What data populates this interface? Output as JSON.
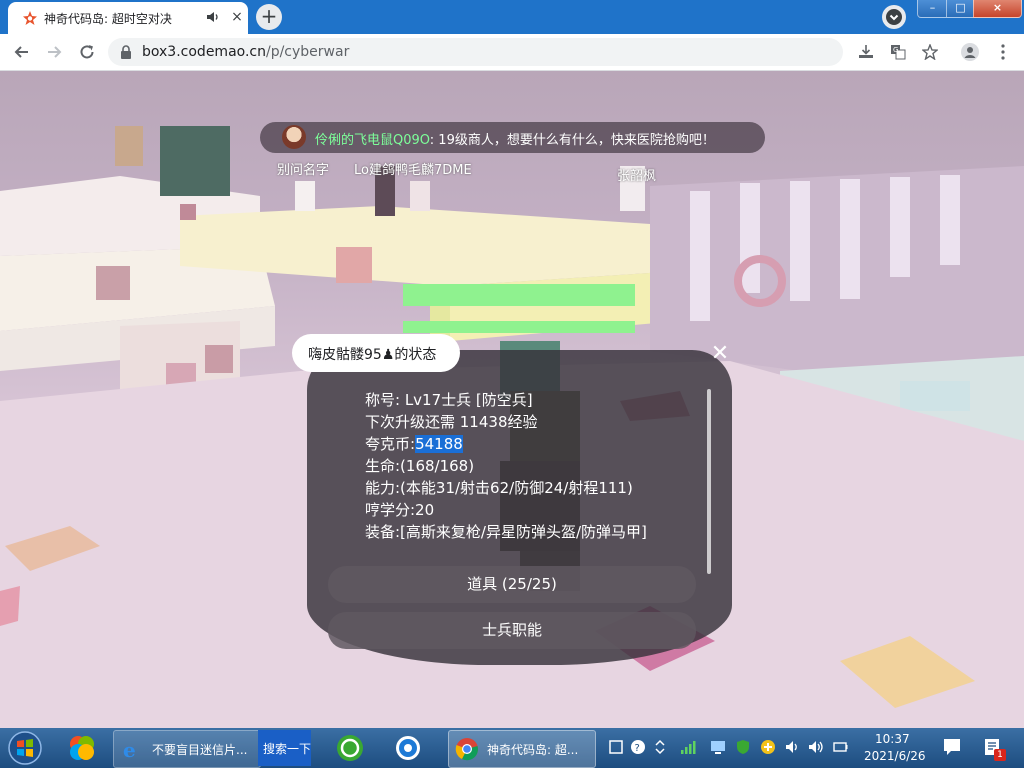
{
  "browser": {
    "tab_title": "神奇代码岛: 超时空对决",
    "tab_close": "×",
    "new_tab": "+",
    "url_host": "box3.codemao.cn",
    "url_path": "/p/cyberwar"
  },
  "window_controls": {
    "minimize": "–",
    "maximize": "□",
    "close": "×"
  },
  "game": {
    "broadcast": {
      "sender": "伶俐的飞电鼠Q09O",
      "message": ": 19级商人，想要什么有什么，快来医院抢购吧！"
    },
    "npc_labels": [
      "别问名字",
      "Lo建鸽鸭毛麟7DME",
      "张韶枫"
    ],
    "status_panel": {
      "title": "嗨皮骷髅95♟的状态",
      "close": "✕",
      "stats": [
        {
          "label": "称号: Lv17士兵 [防空兵]"
        },
        {
          "label": "下次升级还需 11438经验"
        },
        {
          "label": "夸克币:",
          "value": "54188"
        },
        {
          "label": "生命:(168/168)"
        },
        {
          "label": "能力:(本能31/射击62/防御24/射程111)"
        },
        {
          "label": "哼学分:20"
        },
        {
          "label": "装备:[高斯来复枪/异星防弹头盔/防弹马甲]"
        }
      ],
      "buttons": [
        "道具 (25/25)",
        "士兵职能"
      ]
    }
  },
  "taskbar": {
    "ie_task_label": "不要盲目迷信片...",
    "search_label": "搜索一下",
    "chrome_task_label": "神奇代码岛: 超...",
    "time": "10:37",
    "date": "2021/6/26",
    "notification_count": "1"
  },
  "colors": {
    "titlebar": "#1f73c9",
    "taskbar": "#2a5d93",
    "broadcast_name": "#7dff9a",
    "selection": "#1a6fd6"
  }
}
